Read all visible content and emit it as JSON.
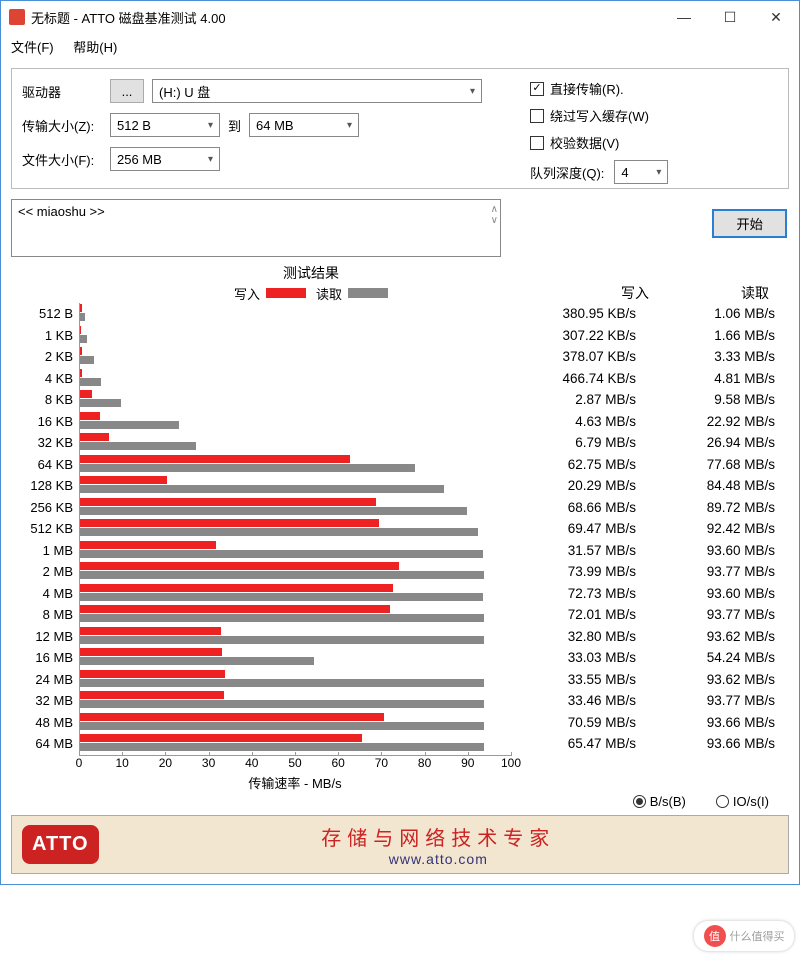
{
  "titlebar": {
    "title": "无标题 - ATTO 磁盘基准测试 4.00"
  },
  "menu": {
    "file": "文件(F)",
    "help": "帮助(H)"
  },
  "config": {
    "drive_label": "驱动器",
    "drive_value": "(H:) U 盘",
    "xfer_label": "传输大小(Z):",
    "xfer_from": "512 B",
    "to_label": "到",
    "xfer_to": "64 MB",
    "filesize_label": "文件大小(F):",
    "filesize_value": "256 MB",
    "direct_io": "直接传输(R).",
    "bypass_cache": "绕过写入缓存(W)",
    "verify": "校验数据(V)",
    "queue_depth_label": "队列深度(Q):",
    "queue_depth_value": "4",
    "textarea": "<< miaoshu >>",
    "start": "开始"
  },
  "results": {
    "title": "测试结果",
    "write_label": "写入",
    "read_label": "读取",
    "col_write": "写入",
    "col_read": "读取",
    "axis_label": "传输速率 - MB/s",
    "radio_bs": "B/s(B)",
    "radio_ios": "IO/s(I)"
  },
  "footer": {
    "logo": "ATTO",
    "text": "存储与网络技术专家",
    "url": "www.atto.com"
  },
  "watermark": "什么值得买",
  "chart_data": {
    "type": "bar",
    "title": "测试结果",
    "xlabel": "传输速率 - MB/s",
    "xlim": [
      0,
      100
    ],
    "categories": [
      "512 B",
      "1 KB",
      "2 KB",
      "4 KB",
      "8 KB",
      "16 KB",
      "32 KB",
      "64 KB",
      "128 KB",
      "256 KB",
      "512 KB",
      "1 MB",
      "2 MB",
      "4 MB",
      "8 MB",
      "12 MB",
      "16 MB",
      "24 MB",
      "32 MB",
      "48 MB",
      "64 MB"
    ],
    "series": [
      {
        "name": "写入 (MB/s)",
        "values": [
          0.38095,
          0.30722,
          0.37807,
          0.46674,
          2.87,
          4.63,
          6.79,
          62.75,
          20.29,
          68.66,
          69.47,
          31.57,
          73.99,
          72.73,
          72.01,
          32.8,
          33.03,
          33.55,
          33.46,
          70.59,
          65.47
        ]
      },
      {
        "name": "读取 (MB/s)",
        "values": [
          1.06,
          1.66,
          3.33,
          4.81,
          9.58,
          22.92,
          26.94,
          77.68,
          84.48,
          89.72,
          92.42,
          93.6,
          93.77,
          93.6,
          93.77,
          93.62,
          54.24,
          93.62,
          93.77,
          93.66,
          93.66
        ]
      }
    ],
    "display": {
      "write": [
        "380.95 KB/s",
        "307.22 KB/s",
        "378.07 KB/s",
        "466.74 KB/s",
        "2.87 MB/s",
        "4.63 MB/s",
        "6.79 MB/s",
        "62.75 MB/s",
        "20.29 MB/s",
        "68.66 MB/s",
        "69.47 MB/s",
        "31.57 MB/s",
        "73.99 MB/s",
        "72.73 MB/s",
        "72.01 MB/s",
        "32.80 MB/s",
        "33.03 MB/s",
        "33.55 MB/s",
        "33.46 MB/s",
        "70.59 MB/s",
        "65.47 MB/s"
      ],
      "read": [
        "1.06 MB/s",
        "1.66 MB/s",
        "3.33 MB/s",
        "4.81 MB/s",
        "9.58 MB/s",
        "22.92 MB/s",
        "26.94 MB/s",
        "77.68 MB/s",
        "84.48 MB/s",
        "89.72 MB/s",
        "92.42 MB/s",
        "93.60 MB/s",
        "93.77 MB/s",
        "93.60 MB/s",
        "93.77 MB/s",
        "93.62 MB/s",
        "54.24 MB/s",
        "93.62 MB/s",
        "93.77 MB/s",
        "93.66 MB/s",
        "93.66 MB/s"
      ]
    }
  }
}
